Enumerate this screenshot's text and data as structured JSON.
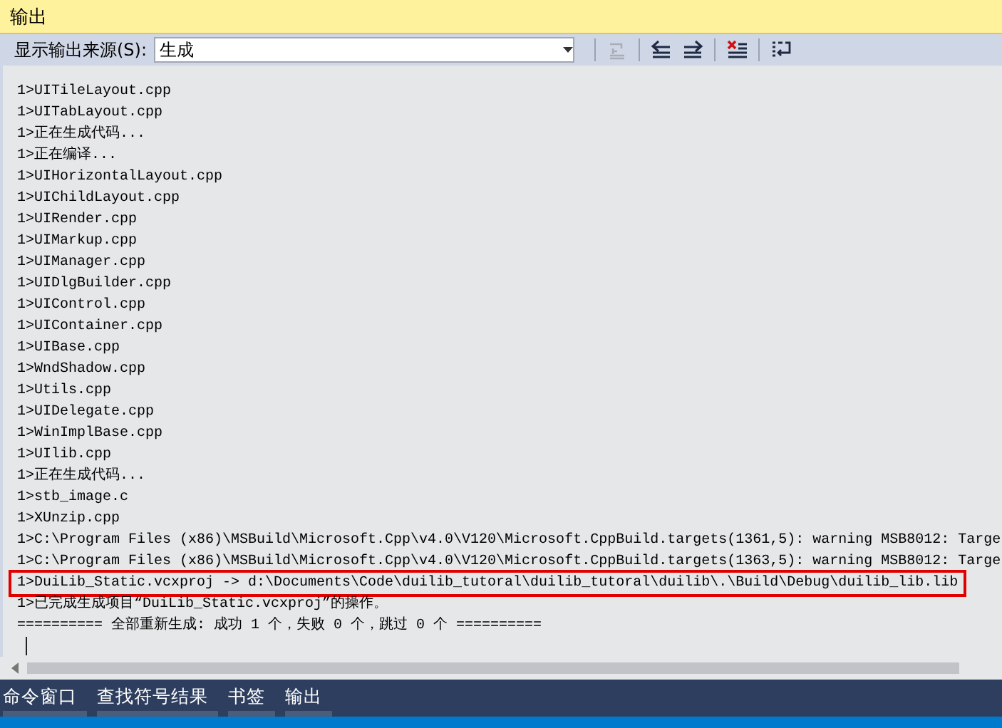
{
  "window": {
    "title": "输出"
  },
  "toolbar": {
    "source_label": "显示输出来源(S):",
    "source_value": "生成",
    "buttons": [
      {
        "kind": "goto",
        "disabled": true
      },
      {
        "kind": "prev",
        "disabled": false
      },
      {
        "kind": "next",
        "disabled": false
      },
      {
        "kind": "clear",
        "disabled": false
      },
      {
        "kind": "wrap",
        "disabled": false
      }
    ]
  },
  "output_lines": [
    {
      "text": "1>UITileLayout.cpp",
      "highlighted": false
    },
    {
      "text": "1>UITabLayout.cpp",
      "highlighted": false
    },
    {
      "text": "1>正在生成代码...",
      "highlighted": false
    },
    {
      "text": "1>正在编译...",
      "highlighted": false
    },
    {
      "text": "1>UIHorizontalLayout.cpp",
      "highlighted": false
    },
    {
      "text": "1>UIChildLayout.cpp",
      "highlighted": false
    },
    {
      "text": "1>UIRender.cpp",
      "highlighted": false
    },
    {
      "text": "1>UIMarkup.cpp",
      "highlighted": false
    },
    {
      "text": "1>UIManager.cpp",
      "highlighted": false
    },
    {
      "text": "1>UIDlgBuilder.cpp",
      "highlighted": false
    },
    {
      "text": "1>UIControl.cpp",
      "highlighted": false
    },
    {
      "text": "1>UIContainer.cpp",
      "highlighted": false
    },
    {
      "text": "1>UIBase.cpp",
      "highlighted": false
    },
    {
      "text": "1>WndShadow.cpp",
      "highlighted": false
    },
    {
      "text": "1>Utils.cpp",
      "highlighted": false
    },
    {
      "text": "1>UIDelegate.cpp",
      "highlighted": false
    },
    {
      "text": "1>WinImplBase.cpp",
      "highlighted": false
    },
    {
      "text": "1>UIlib.cpp",
      "highlighted": false
    },
    {
      "text": "1>正在生成代码...",
      "highlighted": false
    },
    {
      "text": "1>stb_image.c",
      "highlighted": false
    },
    {
      "text": "1>XUnzip.cpp",
      "highlighted": false
    },
    {
      "text": "1>C:\\Program Files (x86)\\MSBuild\\Microsoft.Cpp\\v4.0\\V120\\Microsoft.CppBuild.targets(1361,5): warning MSB8012: Targe",
      "highlighted": false
    },
    {
      "text": "1>C:\\Program Files (x86)\\MSBuild\\Microsoft.Cpp\\v4.0\\V120\\Microsoft.CppBuild.targets(1363,5): warning MSB8012: Targe",
      "highlighted": false
    },
    {
      "text": "1>DuiLib_Static.vcxproj -> d:\\Documents\\Code\\duilib_tutoral\\duilib_tutoral\\duilib\\.\\Build\\Debug\\duilib_lib.lib",
      "highlighted": true
    },
    {
      "text": "1>已完成生成项目“DuiLib_Static.vcxproj”的操作。",
      "highlighted": false
    },
    {
      "text": "========== 全部重新生成: 成功 1 个，失败 0 个，跳过 0 个 ==========",
      "highlighted": false
    }
  ],
  "bottom_tabs": [
    {
      "label": "命令窗口"
    },
    {
      "label": "查找符号结果"
    },
    {
      "label": "书签"
    },
    {
      "label": "输出"
    }
  ]
}
